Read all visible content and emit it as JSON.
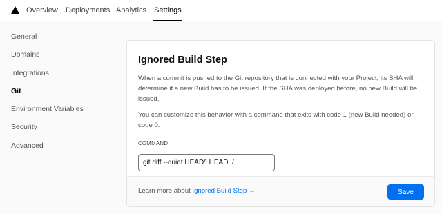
{
  "nav": {
    "tabs": [
      {
        "label": "Overview"
      },
      {
        "label": "Deployments"
      },
      {
        "label": "Analytics"
      },
      {
        "label": "Settings"
      }
    ],
    "active": "Settings"
  },
  "sidebar": {
    "items": [
      {
        "label": "General"
      },
      {
        "label": "Domains"
      },
      {
        "label": "Integrations"
      },
      {
        "label": "Git"
      },
      {
        "label": "Environment Variables"
      },
      {
        "label": "Security"
      },
      {
        "label": "Advanced"
      }
    ],
    "active": "Git"
  },
  "card": {
    "title": "Ignored Build Step",
    "description": "When a commit is pushed to the Git repository that is connected with your Project, its SHA will determine if a new Build has to be issued. If the SHA was deployed before, no new Build will be issued.",
    "description2": "You can customize this behavior with a command that exits with code 1 (new Build needed) or code 0.",
    "command_label": "COMMAND",
    "command_value": "git diff --quiet HEAD^ HEAD ./",
    "footer_text": "Learn more about",
    "footer_link": "Ignored Build Step →",
    "save_label": "Save"
  },
  "colors": {
    "accent": "#0070f3"
  },
  "icons": {
    "logo": "triangle-logo-icon"
  }
}
